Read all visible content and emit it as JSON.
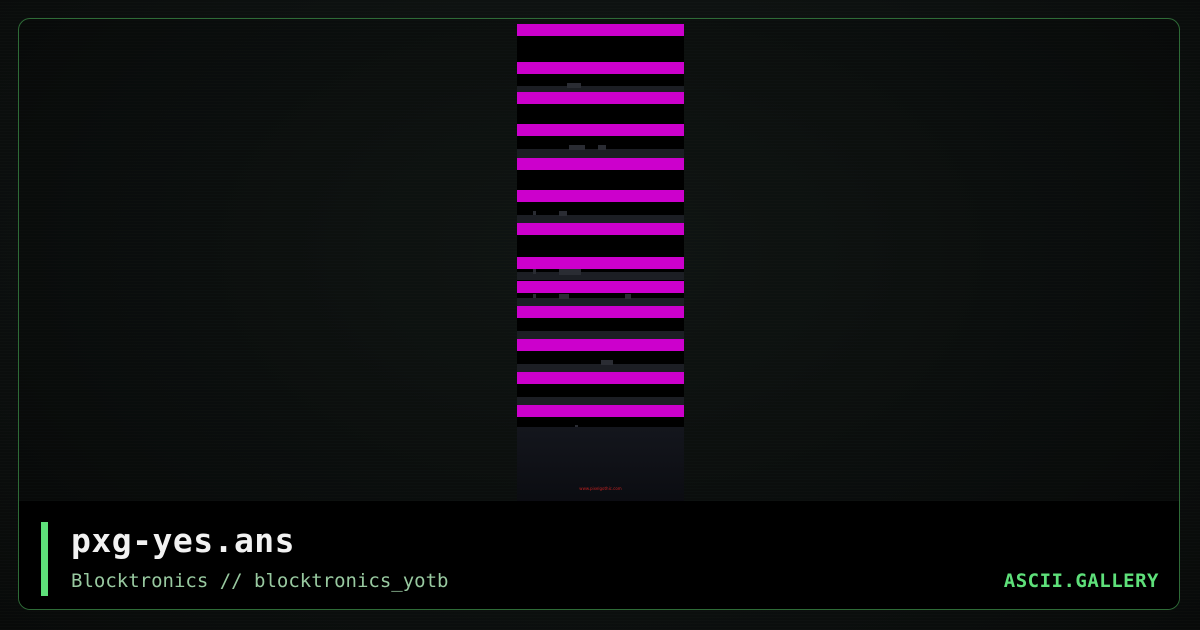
{
  "card": {
    "filename": "pxg-yes.ans",
    "byline": "Blocktronics // blocktronics_yotb",
    "brand": "ASCII.GALLERY"
  },
  "artwork": {
    "url_text": "www.pixelgothic.com"
  },
  "colors": {
    "accent": "#5ee07a",
    "magenta": "#cc00cc",
    "frame_border": "#2e6b37",
    "title": "#f2f2f2",
    "subtitle": "#98c9a0"
  }
}
